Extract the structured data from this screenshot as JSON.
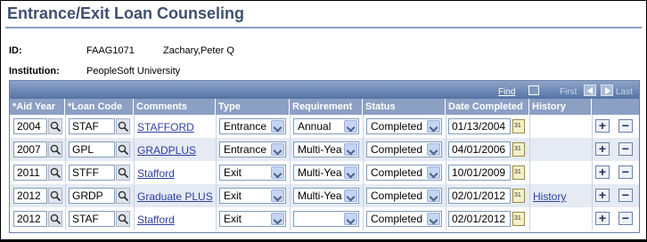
{
  "page": {
    "title": "Entrance/Exit Loan Counseling"
  },
  "fields": {
    "id_label": "ID:",
    "id_value": "FAAG1071",
    "name_value": "Zachary,Peter Q",
    "institution_label": "Institution:",
    "institution_value": "PeopleSoft University"
  },
  "grid": {
    "find": "Find",
    "first": "First",
    "last": "Last",
    "columns": [
      "*Aid Year",
      "*Loan Code",
      "Comments",
      "Type",
      "Requirement",
      "Status",
      "Date Completed",
      "History"
    ],
    "rows": [
      {
        "aid_year": "2004",
        "loan_code": "STAF",
        "comments": "STAFFORD",
        "type": "Entrance",
        "requirement": "Annual",
        "status": "Completed",
        "date": "01/13/2004",
        "history": ""
      },
      {
        "aid_year": "2007",
        "loan_code": "GPL",
        "comments": "GRADPLUS",
        "type": "Entrance",
        "requirement": "Multi-Yea",
        "status": "Completed",
        "date": "04/01/2006",
        "history": ""
      },
      {
        "aid_year": "2011",
        "loan_code": "STFF",
        "comments": "Stafford",
        "type": "Exit",
        "requirement": "Multi-Yea",
        "status": "Completed",
        "date": "10/01/2009",
        "history": ""
      },
      {
        "aid_year": "2012",
        "loan_code": "GRDP",
        "comments": "Graduate PLUS",
        "type": "Exit",
        "requirement": "Multi-Yea",
        "status": "Completed",
        "date": "02/01/2012",
        "history": "History"
      },
      {
        "aid_year": "2012",
        "loan_code": "STAF",
        "comments": "Stafford",
        "type": "Exit",
        "requirement": "",
        "status": "Completed",
        "date": "02/01/2012",
        "history": ""
      }
    ]
  }
}
